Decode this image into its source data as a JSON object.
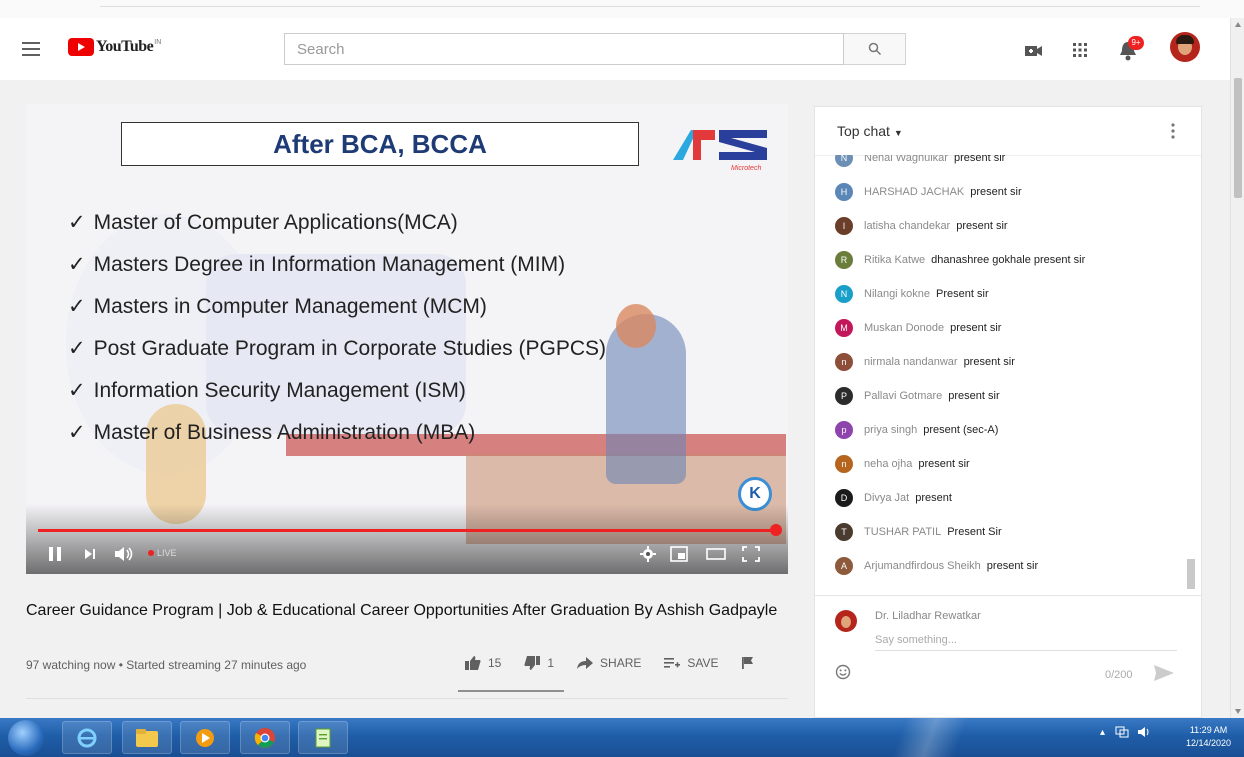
{
  "masthead": {
    "logo_text": "YouTube",
    "logo_sup": "IN",
    "search_placeholder": "Search",
    "notification_count": "9+"
  },
  "video": {
    "slide_title": "After BCA, BCCA",
    "logo_text": "APS",
    "logo_subtext": "Microtech",
    "programs": [
      "Master of Computer Applications(MCA)",
      "Masters Degree in Information Management (MIM)",
      "Masters in Computer Management (MCM)",
      "Post Graduate Program in Corporate Studies (PGPCS)",
      "Information Security Management (ISM)",
      "Master of Business Administration (MBA)"
    ],
    "check_mark": "✓",
    "live_label": "LIVE",
    "title": "Career Guidance Program | Job & Educational Career Opportunities After Graduation By Ashish Gadpayle",
    "meta": "97 watching now • Started streaming 27 minutes ago",
    "likes": "15",
    "dislikes": "1",
    "share_label": "SHARE",
    "save_label": "SAVE"
  },
  "chat": {
    "header": "Top chat",
    "messages": [
      {
        "name": "Nehal Waghulkar",
        "text": "present sir",
        "color": "#6b8fb5",
        "initial": "N"
      },
      {
        "name": "HARSHAD JACHAK",
        "text": "present sir",
        "color": "#5b86b8",
        "initial": "H"
      },
      {
        "name": "latisha chandekar",
        "text": "present sir",
        "color": "#6b3e2a",
        "initial": "l"
      },
      {
        "name": "Ritika Katwe",
        "text": "dhanashree gokhale present sir",
        "color": "#6a7d3a",
        "initial": "R"
      },
      {
        "name": "Nilangi kokne",
        "text": "Present sir",
        "color": "#1aa0c8",
        "initial": "N"
      },
      {
        "name": "Muskan Donode",
        "text": "present sir",
        "color": "#c2185b",
        "initial": "M"
      },
      {
        "name": "nirmala nandanwar",
        "text": "present sir",
        "color": "#8d4e3a",
        "initial": "n"
      },
      {
        "name": "Pallavi Gotmare",
        "text": "present sir",
        "color": "#2b2b2b",
        "initial": "P"
      },
      {
        "name": "priya singh",
        "text": "present (sec-A)",
        "color": "#8e44ad",
        "initial": "p"
      },
      {
        "name": "neha ojha",
        "text": "present sir",
        "color": "#b5651d",
        "initial": "n"
      },
      {
        "name": "Divya Jat",
        "text": "present",
        "color": "#1b1b1b",
        "initial": "D"
      },
      {
        "name": "TUSHAR PATIL",
        "text": "Present Sir",
        "color": "#4a3b2f",
        "initial": "T"
      },
      {
        "name": "Arjumandfirdous Sheikh",
        "text": "present sir",
        "color": "#8d5a3b",
        "initial": "A"
      }
    ],
    "composer_name": "Dr. Liladhar Rewatkar",
    "composer_placeholder": "Say something...",
    "char_count": "0/200"
  },
  "taskbar": {
    "time": "11:29 AM",
    "date": "12/14/2020"
  },
  "colors": {
    "youtube_red": "#ff0000",
    "slide_title": "#1f3b75",
    "progress": "#ee2222",
    "taskbar": "#1f5ea8"
  }
}
